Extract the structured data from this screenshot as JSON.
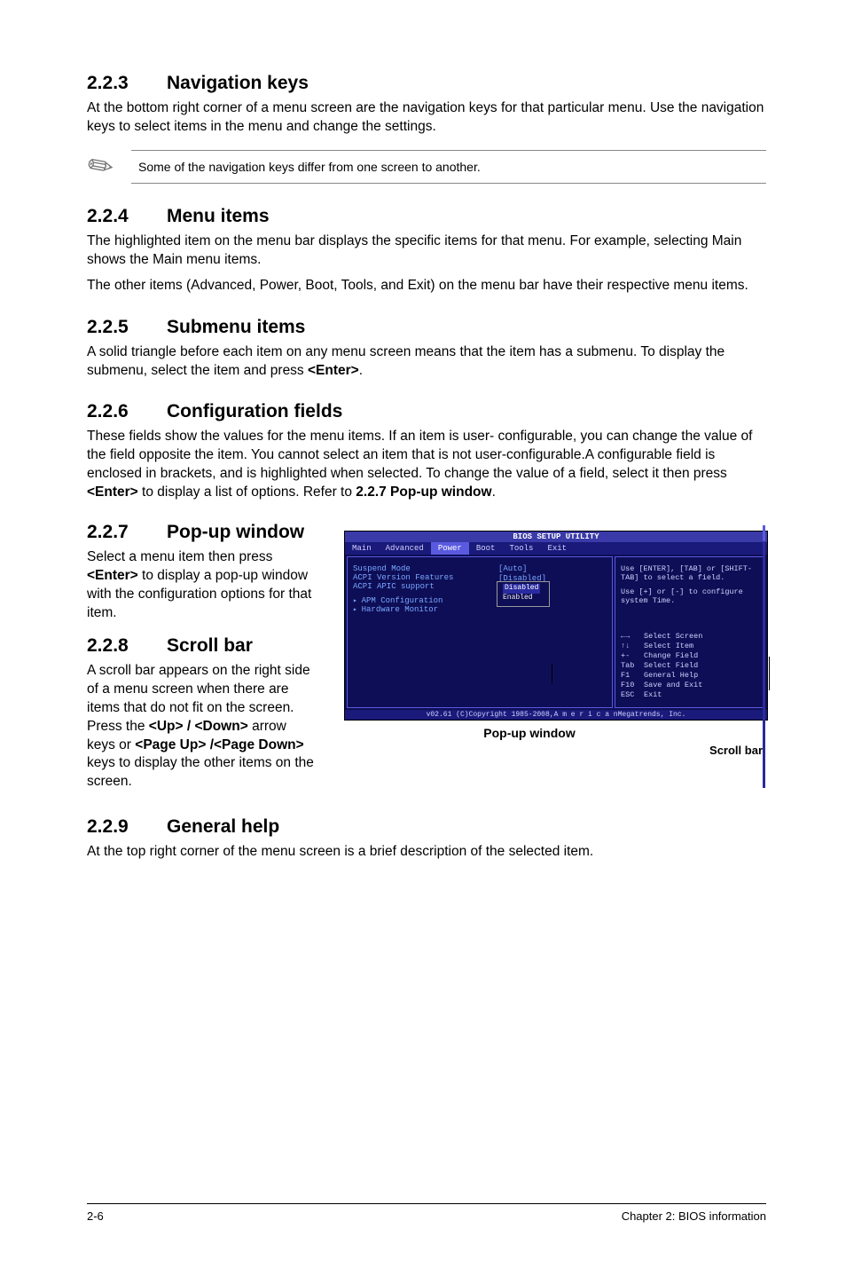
{
  "sections": {
    "s223": {
      "num": "2.2.3",
      "title": "Navigation keys",
      "p1": "At the bottom right corner of a menu screen are the navigation keys for that particular menu. Use the navigation keys to select items in the menu and change the settings.",
      "note": "Some of the navigation keys differ from one screen to another."
    },
    "s224": {
      "num": "2.2.4",
      "title": "Menu items",
      "p1": "The highlighted item on the menu bar displays the specific items for that menu. For example, selecting Main shows the Main menu items.",
      "p2": "The other items (Advanced, Power, Boot, Tools, and Exit) on the menu bar have their respective menu items."
    },
    "s225": {
      "num": "2.2.5",
      "title": "Submenu items",
      "p1": "A solid triangle before each item on any menu screen means that the item has a submenu. To display the submenu, select the item and press <Enter>."
    },
    "s226": {
      "num": "2.2.6",
      "title": "Configuration fields",
      "p1": "These fields show the values for the menu items. If an item is user- configurable, you can change the value of the field opposite the item. You cannot select an item that is not user-configurable.A configurable field is enclosed in brackets, and is highlighted when selected. To change the value of a field, select it then press <Enter> to display a list of options. Refer to 2.2.7 Pop-up window."
    },
    "s227": {
      "num": "2.2.7",
      "title": "Pop-up window",
      "p1": "Select a menu item then press <Enter> to display a pop-up window with the configuration options for that item."
    },
    "s228": {
      "num": "2.2.8",
      "title": "Scroll bar",
      "p1": "A scroll bar appears on the right side of a menu screen when there are items that do not fit on the screen. Press the <Up> / <Down> arrow keys or <Page Up> /<Page Down> keys to display the other items on the screen."
    },
    "s229": {
      "num": "2.2.9",
      "title": "General help",
      "p1": "At the top right corner of the menu screen is a brief description of the selected item."
    }
  },
  "bios": {
    "title": "BIOS SETUP UTILITY",
    "menu": {
      "main": "Main",
      "advanced": "Advanced",
      "power": "Power",
      "boot": "Boot",
      "tools": "Tools",
      "exit": "Exit"
    },
    "left": {
      "i1": "Suspend Mode",
      "v1": "[Auto]",
      "i2": "ACPI Version Features",
      "v2": "[Disabled]",
      "i3": "ACPI APIC support",
      "popup_opt1": "Disabled",
      "popup_opt2": "Enabled",
      "sub1": "APM Configuration",
      "sub2": "Hardware Monitor"
    },
    "right": {
      "t1": "Use [ENTER], [TAB] or [SHIFT-TAB] to select a field.",
      "t2": "Use [+] or [-] to configure system Time.",
      "k1_s": "←→",
      "k1": "Select Screen",
      "k2_s": "↑↓",
      "k2": "Select Item",
      "k3_s": "+-",
      "k3": "Change Field",
      "k4_s": "Tab",
      "k4": "Select Field",
      "k5_s": "F1",
      "k5": "General Help",
      "k6_s": "F10",
      "k6": "Save and Exit",
      "k7_s": "ESC",
      "k7": "Exit"
    },
    "footer": "v02.61 (C)Copyright 1985-2008,A m e r i c a nMegatrends, Inc."
  },
  "callouts": {
    "popup": "Pop-up window",
    "scroll": "Scroll bar"
  },
  "footer": {
    "left": "2-6",
    "right": "Chapter 2: BIOS information"
  }
}
